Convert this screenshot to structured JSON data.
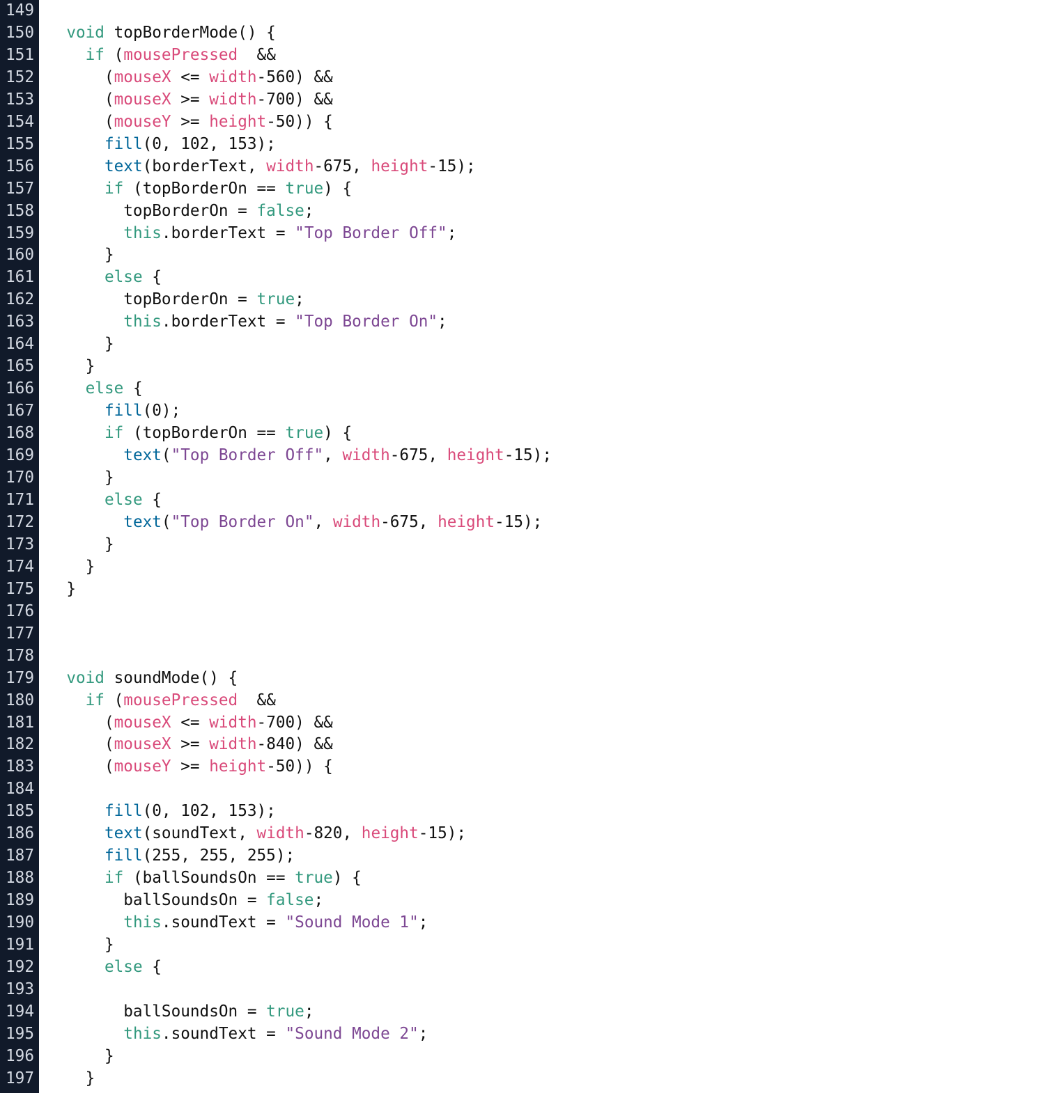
{
  "editor": {
    "colors": {
      "gutter_background": "#111a2a",
      "gutter_text": "#d4d9e2",
      "background": "#ffffff",
      "plain": "#111111",
      "keyword": "#33997e",
      "function": "#006699",
      "variable": "#d94a7a",
      "string": "#7d4793"
    },
    "lines": [
      {
        "num": "149",
        "tokens": []
      },
      {
        "num": "150",
        "tokens": [
          {
            "t": "  "
          },
          {
            "t": "void",
            "c": "kw"
          },
          {
            "t": " topBorderMode() {"
          }
        ]
      },
      {
        "num": "151",
        "tokens": [
          {
            "t": "    "
          },
          {
            "t": "if",
            "c": "kw"
          },
          {
            "t": " ("
          },
          {
            "t": "mousePressed",
            "c": "var"
          },
          {
            "t": "  &&"
          }
        ]
      },
      {
        "num": "152",
        "tokens": [
          {
            "t": "      ("
          },
          {
            "t": "mouseX",
            "c": "var"
          },
          {
            "t": " <= "
          },
          {
            "t": "width",
            "c": "var"
          },
          {
            "t": "-560) &&"
          }
        ]
      },
      {
        "num": "153",
        "tokens": [
          {
            "t": "      ("
          },
          {
            "t": "mouseX",
            "c": "var"
          },
          {
            "t": " >= "
          },
          {
            "t": "width",
            "c": "var"
          },
          {
            "t": "-700) &&"
          }
        ]
      },
      {
        "num": "154",
        "tokens": [
          {
            "t": "      ("
          },
          {
            "t": "mouseY",
            "c": "var"
          },
          {
            "t": " >= "
          },
          {
            "t": "height",
            "c": "var"
          },
          {
            "t": "-50)) {"
          }
        ]
      },
      {
        "num": "155",
        "tokens": [
          {
            "t": "      "
          },
          {
            "t": "fill",
            "c": "fn"
          },
          {
            "t": "(0, 102, 153);"
          }
        ]
      },
      {
        "num": "156",
        "tokens": [
          {
            "t": "      "
          },
          {
            "t": "text",
            "c": "fn"
          },
          {
            "t": "(borderText, "
          },
          {
            "t": "width",
            "c": "var"
          },
          {
            "t": "-675, "
          },
          {
            "t": "height",
            "c": "var"
          },
          {
            "t": "-15);"
          }
        ]
      },
      {
        "num": "157",
        "tokens": [
          {
            "t": "      "
          },
          {
            "t": "if",
            "c": "kw"
          },
          {
            "t": " (topBorderOn == "
          },
          {
            "t": "true",
            "c": "kw"
          },
          {
            "t": ") {"
          }
        ]
      },
      {
        "num": "158",
        "tokens": [
          {
            "t": "        topBorderOn = "
          },
          {
            "t": "false",
            "c": "kw"
          },
          {
            "t": ";"
          }
        ]
      },
      {
        "num": "159",
        "tokens": [
          {
            "t": "        "
          },
          {
            "t": "this",
            "c": "kw"
          },
          {
            "t": ".borderText = "
          },
          {
            "t": "\"Top Border Off\"",
            "c": "str"
          },
          {
            "t": ";"
          }
        ]
      },
      {
        "num": "160",
        "tokens": [
          {
            "t": "      }"
          }
        ]
      },
      {
        "num": "161",
        "tokens": [
          {
            "t": "      "
          },
          {
            "t": "else",
            "c": "kw"
          },
          {
            "t": " {"
          }
        ]
      },
      {
        "num": "162",
        "tokens": [
          {
            "t": "        topBorderOn = "
          },
          {
            "t": "true",
            "c": "kw"
          },
          {
            "t": ";"
          }
        ]
      },
      {
        "num": "163",
        "tokens": [
          {
            "t": "        "
          },
          {
            "t": "this",
            "c": "kw"
          },
          {
            "t": ".borderText = "
          },
          {
            "t": "\"Top Border On\"",
            "c": "str"
          },
          {
            "t": ";"
          }
        ]
      },
      {
        "num": "164",
        "tokens": [
          {
            "t": "      }"
          }
        ]
      },
      {
        "num": "165",
        "tokens": [
          {
            "t": "    }"
          }
        ]
      },
      {
        "num": "166",
        "tokens": [
          {
            "t": "    "
          },
          {
            "t": "else",
            "c": "kw"
          },
          {
            "t": " {"
          }
        ]
      },
      {
        "num": "167",
        "tokens": [
          {
            "t": "      "
          },
          {
            "t": "fill",
            "c": "fn"
          },
          {
            "t": "(0);"
          }
        ]
      },
      {
        "num": "168",
        "tokens": [
          {
            "t": "      "
          },
          {
            "t": "if",
            "c": "kw"
          },
          {
            "t": " (topBorderOn == "
          },
          {
            "t": "true",
            "c": "kw"
          },
          {
            "t": ") {"
          }
        ]
      },
      {
        "num": "169",
        "tokens": [
          {
            "t": "        "
          },
          {
            "t": "text",
            "c": "fn"
          },
          {
            "t": "("
          },
          {
            "t": "\"Top Border Off\"",
            "c": "str"
          },
          {
            "t": ", "
          },
          {
            "t": "width",
            "c": "var"
          },
          {
            "t": "-675, "
          },
          {
            "t": "height",
            "c": "var"
          },
          {
            "t": "-15);"
          }
        ]
      },
      {
        "num": "170",
        "tokens": [
          {
            "t": "      }"
          }
        ]
      },
      {
        "num": "171",
        "tokens": [
          {
            "t": "      "
          },
          {
            "t": "else",
            "c": "kw"
          },
          {
            "t": " {"
          }
        ]
      },
      {
        "num": "172",
        "tokens": [
          {
            "t": "        "
          },
          {
            "t": "text",
            "c": "fn"
          },
          {
            "t": "("
          },
          {
            "t": "\"Top Border On\"",
            "c": "str"
          },
          {
            "t": ", "
          },
          {
            "t": "width",
            "c": "var"
          },
          {
            "t": "-675, "
          },
          {
            "t": "height",
            "c": "var"
          },
          {
            "t": "-15);"
          }
        ]
      },
      {
        "num": "173",
        "tokens": [
          {
            "t": "      }"
          }
        ]
      },
      {
        "num": "174",
        "tokens": [
          {
            "t": "    }"
          }
        ]
      },
      {
        "num": "175",
        "tokens": [
          {
            "t": "  }"
          }
        ]
      },
      {
        "num": "176",
        "tokens": []
      },
      {
        "num": "177",
        "tokens": []
      },
      {
        "num": "178",
        "tokens": []
      },
      {
        "num": "179",
        "tokens": [
          {
            "t": "  "
          },
          {
            "t": "void",
            "c": "kw"
          },
          {
            "t": " soundMode() {"
          }
        ]
      },
      {
        "num": "180",
        "tokens": [
          {
            "t": "    "
          },
          {
            "t": "if",
            "c": "kw"
          },
          {
            "t": " ("
          },
          {
            "t": "mousePressed",
            "c": "var"
          },
          {
            "t": "  &&"
          }
        ]
      },
      {
        "num": "181",
        "tokens": [
          {
            "t": "      ("
          },
          {
            "t": "mouseX",
            "c": "var"
          },
          {
            "t": " <= "
          },
          {
            "t": "width",
            "c": "var"
          },
          {
            "t": "-700) &&"
          }
        ]
      },
      {
        "num": "182",
        "tokens": [
          {
            "t": "      ("
          },
          {
            "t": "mouseX",
            "c": "var"
          },
          {
            "t": " >= "
          },
          {
            "t": "width",
            "c": "var"
          },
          {
            "t": "-840) &&"
          }
        ]
      },
      {
        "num": "183",
        "tokens": [
          {
            "t": "      ("
          },
          {
            "t": "mouseY",
            "c": "var"
          },
          {
            "t": " >= "
          },
          {
            "t": "height",
            "c": "var"
          },
          {
            "t": "-50)) {"
          }
        ]
      },
      {
        "num": "184",
        "tokens": []
      },
      {
        "num": "185",
        "tokens": [
          {
            "t": "      "
          },
          {
            "t": "fill",
            "c": "fn"
          },
          {
            "t": "(0, 102, 153);"
          }
        ]
      },
      {
        "num": "186",
        "tokens": [
          {
            "t": "      "
          },
          {
            "t": "text",
            "c": "fn"
          },
          {
            "t": "(soundText, "
          },
          {
            "t": "width",
            "c": "var"
          },
          {
            "t": "-820, "
          },
          {
            "t": "height",
            "c": "var"
          },
          {
            "t": "-15);"
          }
        ]
      },
      {
        "num": "187",
        "tokens": [
          {
            "t": "      "
          },
          {
            "t": "fill",
            "c": "fn"
          },
          {
            "t": "(255, 255, 255);"
          }
        ]
      },
      {
        "num": "188",
        "tokens": [
          {
            "t": "      "
          },
          {
            "t": "if",
            "c": "kw"
          },
          {
            "t": " (ballSoundsOn == "
          },
          {
            "t": "true",
            "c": "kw"
          },
          {
            "t": ") {"
          }
        ]
      },
      {
        "num": "189",
        "tokens": [
          {
            "t": "        ballSoundsOn = "
          },
          {
            "t": "false",
            "c": "kw"
          },
          {
            "t": ";"
          }
        ]
      },
      {
        "num": "190",
        "tokens": [
          {
            "t": "        "
          },
          {
            "t": "this",
            "c": "kw"
          },
          {
            "t": ".soundText = "
          },
          {
            "t": "\"Sound Mode 1\"",
            "c": "str"
          },
          {
            "t": ";"
          }
        ]
      },
      {
        "num": "191",
        "tokens": [
          {
            "t": "      }"
          }
        ]
      },
      {
        "num": "192",
        "tokens": [
          {
            "t": "      "
          },
          {
            "t": "else",
            "c": "kw"
          },
          {
            "t": " {"
          }
        ]
      },
      {
        "num": "193",
        "tokens": []
      },
      {
        "num": "194",
        "tokens": [
          {
            "t": "        ballSoundsOn = "
          },
          {
            "t": "true",
            "c": "kw"
          },
          {
            "t": ";"
          }
        ]
      },
      {
        "num": "195",
        "tokens": [
          {
            "t": "        "
          },
          {
            "t": "this",
            "c": "kw"
          },
          {
            "t": ".soundText = "
          },
          {
            "t": "\"Sound Mode 2\"",
            "c": "str"
          },
          {
            "t": ";"
          }
        ]
      },
      {
        "num": "196",
        "tokens": [
          {
            "t": "      }"
          }
        ]
      },
      {
        "num": "197",
        "tokens": [
          {
            "t": "    }"
          }
        ]
      }
    ]
  }
}
